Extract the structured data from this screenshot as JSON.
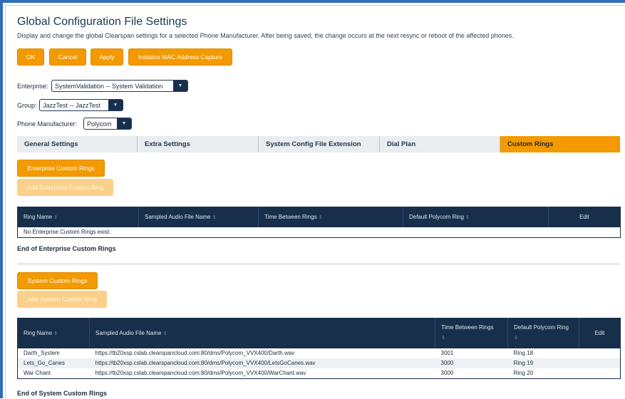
{
  "title": "Global Configuration File Settings",
  "description": "Display and change the global Clearspan settings for a selected Phone Manufacturer. After being saved, the change occurs at the next resync or reboot of the affected phones.",
  "toolbar": {
    "ok": "OK",
    "cancel": "Cancel",
    "apply": "Apply",
    "init_mac": "Initialize MAC Address Capture"
  },
  "filters": {
    "enterprise_label": "Enterprise:",
    "enterprise_value": "SystemValidation -- System Validation",
    "group_label": "Group:",
    "group_value": "JazzTest -- JazzTest",
    "manufacturer_label": "Phone Manufacturer:",
    "manufacturer_value": "Polycom"
  },
  "tabs": [
    {
      "label": "General Settings"
    },
    {
      "label": "Extra Settings"
    },
    {
      "label": "System Config File Extension"
    },
    {
      "label": "Dial Plan"
    },
    {
      "label": "Custom Rings",
      "active": true
    }
  ],
  "enterprise": {
    "button": "Enterprise Custom Rings",
    "add_button": "Add Enterprise Custom Ring",
    "columns": [
      "Ring Name",
      "Sampled Audio File Name",
      "Time Between Rings",
      "Default Polycom Ring",
      "Edit"
    ],
    "empty": "No Enterprise Custom Rings exist.",
    "end": "End of Enterprise Custom Rings"
  },
  "system": {
    "button": "System Custom Rings",
    "add_button": "Add System Custom Ring",
    "columns": [
      "Ring Name",
      "Sampled Audio File Name",
      "Time Between Rings",
      "Default Polycom Ring",
      "Edit"
    ],
    "rows": [
      {
        "name": "Darth_System",
        "file": "https://tb20xsp.cslab.clearspancloud.com:80/dms/Polycom_VVX400/Darth.wav",
        "time": "3001",
        "ring": "Ring 18"
      },
      {
        "name": "Lets_Go_Canes",
        "file": "https://tb20xsp.cslab.clearspancloud.com:80/dms/Polycom_VVX400/LetsGoCanes.wav",
        "time": "3000",
        "ring": "Ring 19"
      },
      {
        "name": "War Chant",
        "file": "https://tb20xsp.cslab.clearspancloud.com:80/dms/Polycom_VVX400/WarChant.wav",
        "time": "3000",
        "ring": "Ring 20"
      }
    ],
    "end": "End of System Custom Rings"
  },
  "icons": {
    "dropdown": "chevron-down-icon",
    "sort": "sort-icon"
  },
  "colors": {
    "accent": "#f39a00",
    "header": "#172f4b",
    "frame": "#2f6db8"
  }
}
